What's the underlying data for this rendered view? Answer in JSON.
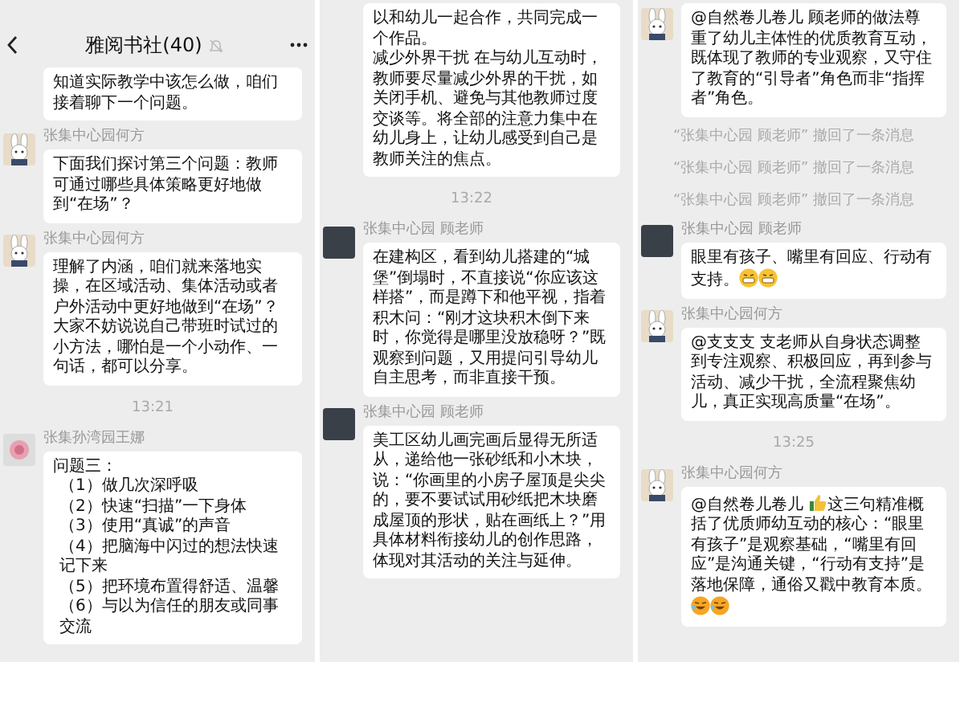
{
  "panels": [
    {
      "header": {
        "title": "雅阅书社(40)"
      },
      "items": [
        {
          "kind": "message",
          "segments": [
            {
              "kind": "text",
              "text": "知道实际教学中该怎么做，咱们接着聊下一个问题。"
            }
          ]
        },
        {
          "kind": "message",
          "sender": "张集中心园何方",
          "avatar": {
            "kind": "rabbit"
          },
          "segments": [
            {
              "kind": "text",
              "text": "下面我们探讨第三个问题：教师可通过哪些具体策略更好地做到“在场”？"
            }
          ]
        },
        {
          "kind": "message",
          "sender": "张集中心园何方",
          "avatar": {
            "kind": "rabbit"
          },
          "segments": [
            {
              "kind": "text",
              "text": "理解了内涵，咱们就来落地实操，在区域活动、集体活动或者户外活动中更好地做到“在场”？大家不妨说说自己带班时试过的小方法，哪怕是一个小动作、一句话，都可以分享。"
            }
          ]
        },
        {
          "kind": "time",
          "text": "13:21"
        },
        {
          "kind": "message",
          "sender": "张集孙湾园王娜",
          "avatar": {
            "kind": "flower"
          },
          "segments": [
            {
              "kind": "para",
              "text": "问题三："
            },
            {
              "kind": "item",
              "text": "（1）做几次深呼吸"
            },
            {
              "kind": "item",
              "text": "（2）快速“扫描”一下身体"
            },
            {
              "kind": "item",
              "text": "（3）使用“真诚”的声音"
            },
            {
              "kind": "item",
              "text": "（4）把脑海中闪过的想法快速记下来"
            },
            {
              "kind": "item",
              "text": "（5）把环境布置得舒适、温馨"
            },
            {
              "kind": "item",
              "text": "（6）与以为信任的朋友或同事交流"
            }
          ]
        }
      ]
    },
    {
      "items": [
        {
          "kind": "message",
          "segments": [
            {
              "kind": "para",
              "text": "以和幼儿一起合作，共同完成一个作品。"
            },
            {
              "kind": "para",
              "text": "减少外界干扰 在与幼儿互动时，教师要尽量减少外界的干扰，如关闭手机、避免与其他教师过度交谈等。将全部的注意力集中在幼儿身上，让幼儿感受到自己是教师关注的焦点。"
            }
          ]
        },
        {
          "kind": "time",
          "text": "13:22"
        },
        {
          "kind": "message",
          "sender": "张集中心园 顾老师",
          "avatar": {
            "kind": "photo"
          },
          "segments": [
            {
              "kind": "text",
              "text": "在建构区，看到幼儿搭建的“城堡”倒塌时，不直接说“你应该这样搭”，而是蹲下和他平视，指着积木问：“刚才这块积木倒下来时，你觉得是哪里没放稳呀？”既观察到问题，又用提问引导幼儿自主思考，而非直接干预。"
            }
          ]
        },
        {
          "kind": "message",
          "sender": "张集中心园 顾老师",
          "avatar": {
            "kind": "photo"
          },
          "segments": [
            {
              "kind": "text",
              "text": "美工区幼儿画完画后显得无所适从，递给他一张砂纸和小木块，说：“你画里的小房子屋顶是尖尖的，要不要试试用砂纸把木块磨成屋顶的形状，贴在画纸上？”用具体材料衔接幼儿的创作思路，体现对其活动的关注与延伸。"
            }
          ]
        }
      ]
    },
    {
      "items": [
        {
          "kind": "message",
          "avatar": {
            "kind": "rabbit"
          },
          "segments": [
            {
              "kind": "text",
              "text": "@自然卷儿卷儿 顾老师的做法尊重了幼儿主体性的优质教育互动，既体现了教师的专业观察，又守住了教育的“引导者”角色而非“指挥者”角色。"
            }
          ]
        },
        {
          "kind": "notice",
          "text": "“张集中心园 顾老师” 撤回了一条消息"
        },
        {
          "kind": "notice",
          "text": "“张集中心园 顾老师” 撤回了一条消息"
        },
        {
          "kind": "notice",
          "text": "“张集中心园 顾老师” 撤回了一条消息"
        },
        {
          "kind": "message",
          "sender": "张集中心园 顾老师",
          "avatar": {
            "kind": "photo"
          },
          "segments": [
            {
              "kind": "text",
              "text": "眼里有孩子、嘴里有回应、行动有支持。"
            },
            {
              "kind": "grin"
            },
            {
              "kind": "grin"
            }
          ]
        },
        {
          "kind": "message",
          "sender": "张集中心园何方",
          "avatar": {
            "kind": "rabbit"
          },
          "segments": [
            {
              "kind": "text",
              "text": "@支支支 支老师从自身状态调整到专注观察、积极回应，再到参与活动、减少干扰，全流程聚焦幼儿，真正实现高质量“在场”。"
            }
          ]
        },
        {
          "kind": "time",
          "text": "13:25"
        },
        {
          "kind": "message",
          "sender": "张集中心园何方",
          "avatar": {
            "kind": "rabbit"
          },
          "segments": [
            {
              "kind": "text",
              "text": "@自然卷儿卷儿 "
            },
            {
              "kind": "thumbs-up"
            },
            {
              "kind": "text",
              "text": "这三句精准概括了优质师幼互动的核心：“眼里有孩子”是观察基础，“嘴里有回应”是沟通关键，“行动有支持”是落地保障，通俗又戳中教育本质。"
            },
            {
              "kind": "laugh"
            },
            {
              "kind": "laugh"
            }
          ]
        }
      ]
    }
  ]
}
